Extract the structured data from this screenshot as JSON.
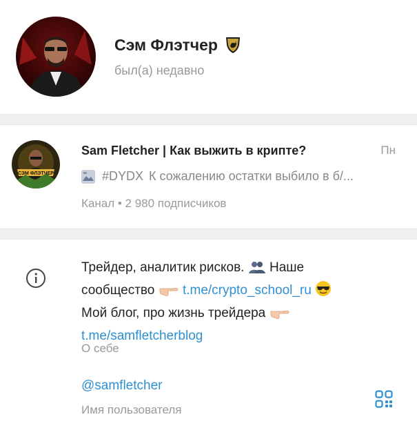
{
  "profile": {
    "name": "Сэм Флэтчер",
    "status": "был(а) недавно",
    "badge_icon": "lamborghini-shield-icon"
  },
  "channel": {
    "title": "Sam Fletcher | Как выжить в крипте?",
    "date": "Пн",
    "preview_tag": "#DYDX",
    "preview_text": "К сожалению остатки выбило в б/...",
    "subscribers": "Канал • 2 980 подписчиков",
    "avatar_text": "СЭМ ФЛЭТЧЕР"
  },
  "info": {
    "bio_line1": "Трейдер, аналитик рисков.",
    "bio_line1_after": " Наше",
    "bio_line2_before": "сообщество",
    "bio_link1": "t.me/crypto_school_ru",
    "bio_line3": "Мой блог, про жизнь трейдера",
    "bio_link2": "t.me/samfletcherblog",
    "about_label": "О себе",
    "username": "@samfletcher",
    "username_label": "Имя пользователя"
  },
  "colors": {
    "link": "#2f8fd1",
    "secondary_text": "#999999",
    "separator": "#f0f0f0"
  }
}
